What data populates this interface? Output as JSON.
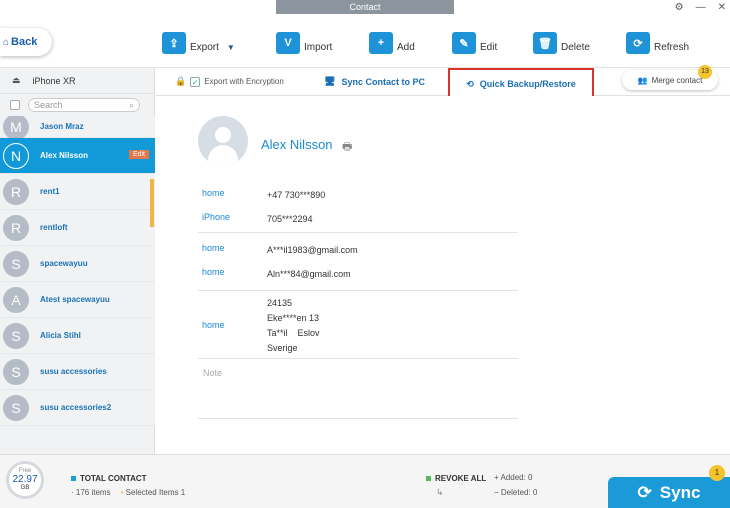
{
  "window": {
    "title": "Contact"
  },
  "toolbar": {
    "back_label": "Back",
    "export_label": "Export",
    "import_label": "Import",
    "add_label": "Add",
    "edit_label": "Edit",
    "delete_label": "Delete",
    "refresh_label": "Refresh"
  },
  "device": {
    "name": "iPhone XR"
  },
  "search": {
    "placeholder": "Search"
  },
  "contacts": [
    {
      "initial": "M",
      "name": "Jason Mraz"
    },
    {
      "initial": "N",
      "name": "Alex Nilsson",
      "badge": "Edit"
    },
    {
      "initial": "R",
      "name": "rent1"
    },
    {
      "initial": "R",
      "name": "rentloft"
    },
    {
      "initial": "S",
      "name": "spacewayuu"
    },
    {
      "initial": "A",
      "name": "Atest spacewayuu"
    },
    {
      "initial": "S",
      "name": "Alicia Stihl"
    },
    {
      "initial": "S",
      "name": "susu accessories"
    },
    {
      "initial": "S",
      "name": "susu accessories2"
    }
  ],
  "tabs": {
    "encryption_label": "Export with Encryption",
    "sync_pc_label": "Sync Contact to PC",
    "quick_backup_label": "Quick Backup/Restore",
    "merge_label": "Merge contact",
    "merge_count": "13"
  },
  "detail": {
    "name": "Alex Nilsson",
    "phones": [
      {
        "label": "home",
        "value": "+47 730***890"
      },
      {
        "label": "iPhone",
        "value": "705***2294"
      }
    ],
    "emails": [
      {
        "label": "home",
        "value": "A***il1983@gmail.com"
      },
      {
        "label": "home",
        "value": "Aln***84@gmail.com"
      }
    ],
    "address": {
      "label": "home",
      "line1": "24135",
      "line2": "Eke****en 13",
      "line3": "Ta**il    Eslov",
      "line4": "Sverige"
    },
    "note_placeholder": "Note"
  },
  "footer": {
    "storage_free_label": "Free",
    "storage_value": "22.97",
    "storage_unit": "GB",
    "total_label": "TOTAL CONTACT",
    "items": "176 items",
    "selected": "Selected Items 1",
    "revoke_label": "REVOKE ALL",
    "added": "Added: 0",
    "deleted": "Deleted: 0",
    "sync_label": "Sync",
    "sync_badge": "1"
  },
  "colors": {
    "accent": "#129ad8",
    "highlight": "#d9342b",
    "badge": "#f6c32c"
  }
}
